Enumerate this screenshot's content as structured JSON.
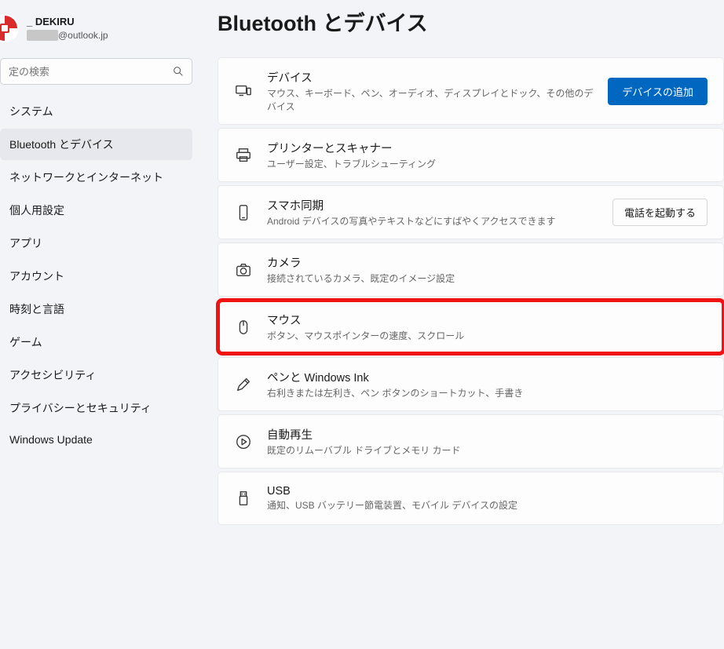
{
  "user": {
    "name": "_ DEKIRU",
    "email_suffix": "@outlook.jp"
  },
  "search": {
    "placeholder": "定の検索"
  },
  "nav": {
    "items": [
      {
        "label": "システム"
      },
      {
        "label": "Bluetooth とデバイス"
      },
      {
        "label": "ネットワークとインターネット"
      },
      {
        "label": "個人用設定"
      },
      {
        "label": "アプリ"
      },
      {
        "label": "アカウント"
      },
      {
        "label": "時刻と言語"
      },
      {
        "label": "ゲーム"
      },
      {
        "label": "アクセシビリティ"
      },
      {
        "label": "プライバシーとセキュリティ"
      },
      {
        "label": "Windows Update"
      }
    ],
    "active_index": 1
  },
  "page": {
    "title": "Bluetooth とデバイス"
  },
  "cards": [
    {
      "icon": "devices-icon",
      "title": "デバイス",
      "sub": "マウス、キーボード、ペン、オーディオ、ディスプレイとドック、その他のデバイス",
      "action": {
        "type": "primary",
        "label": "デバイスの追加"
      }
    },
    {
      "icon": "printer-icon",
      "title": "プリンターとスキャナー",
      "sub": "ユーザー設定、トラブルシューティング"
    },
    {
      "icon": "phone-icon",
      "title": "スマホ同期",
      "sub": "Android デバイスの写真やテキストなどにすばやくアクセスできます",
      "action": {
        "type": "secondary",
        "label": "電話を起動する"
      }
    },
    {
      "icon": "camera-icon",
      "title": "カメラ",
      "sub": "接続されているカメラ、既定のイメージ設定"
    },
    {
      "icon": "mouse-icon",
      "title": "マウス",
      "sub": "ボタン、マウスポインターの速度、スクロール",
      "highlighted": true
    },
    {
      "icon": "pen-icon",
      "title": "ペンと Windows Ink",
      "sub": "右利きまたは左利き、ペン ボタンのショートカット、手書き"
    },
    {
      "icon": "autoplay-icon",
      "title": "自動再生",
      "sub": "既定のリムーバブル ドライブとメモリ カード"
    },
    {
      "icon": "usb-icon",
      "title": "USB",
      "sub": "通知、USB バッテリー節電装置、モバイル デバイスの設定"
    }
  ]
}
